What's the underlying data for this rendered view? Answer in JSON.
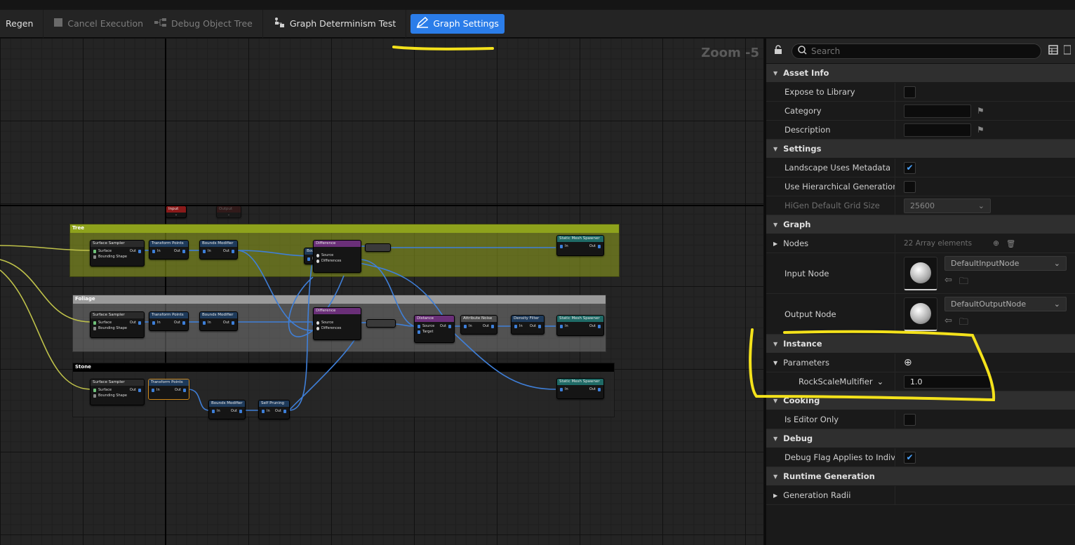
{
  "toolbar": {
    "regen_label": "Regen",
    "cancel_label": "Cancel Execution",
    "debug_tree_label": "Debug Object Tree",
    "determinism_label": "Graph Determinism Test",
    "graph_settings_label": "Graph Settings"
  },
  "graph": {
    "zoom_label": "Zoom -5",
    "input_node": "Input",
    "output_node": "Output",
    "comments": {
      "tree": "Tree",
      "foliage": "Foliage",
      "stone": "Stone"
    },
    "colors": {
      "tree_comment": "#8a9a1a",
      "foliage_comment": "#6a6a6a",
      "stone_comment": "#000000",
      "wire_blue": "#3f7fd8",
      "wire_yellow": "#bfc24a",
      "highlight_yellow": "#f4e21b"
    },
    "nodes": {
      "surface_sampler": "Surface Sampler",
      "surface_pin": "Surface",
      "bounding_shape_pin": "Bounding Shape",
      "transform_points": "Transform Points",
      "bounds_modifier": "Bounds Modifier",
      "difference": "Difference",
      "source_pin": "Source",
      "differences_pin": "Differences",
      "static_mesh_spawner": "Static Mesh Spawner",
      "distance": "Distance",
      "target_pin": "Target",
      "attribute_noise": "Attribute Noise",
      "density_filter": "Density Filter",
      "self_pruning": "Self Pruning",
      "in_pin": "In",
      "out_pin": "Out"
    }
  },
  "panel": {
    "search_placeholder": "Search",
    "sections": {
      "asset_info": "Asset Info",
      "settings": "Settings",
      "graph": "Graph",
      "instance": "Instance",
      "cooking": "Cooking",
      "debug": "Debug",
      "runtime_generation": "Runtime Generation"
    },
    "rows": {
      "expose_to_library": "Expose to Library",
      "category": "Category",
      "description": "Description",
      "landscape_uses_metadata": "Landscape Uses Metadata",
      "use_hierarchical_generation": "Use Hierarchical Generation",
      "higen_default_grid_size": "HiGen Default Grid Size",
      "higen_grid_value": "25600",
      "nodes": "Nodes",
      "nodes_count": "22 Array elements",
      "input_node": "Input Node",
      "input_node_value": "DefaultInputNode",
      "output_node": "Output Node",
      "output_node_value": "DefaultOutputNode",
      "parameters": "Parameters",
      "rock_scale_multiplier": "RockScaleMultifier",
      "rock_scale_value": "1.0",
      "is_editor_only": "Is Editor Only",
      "debug_flag": "Debug Flag Applies to Individ...",
      "generation_radii": "Generation Radii"
    }
  }
}
